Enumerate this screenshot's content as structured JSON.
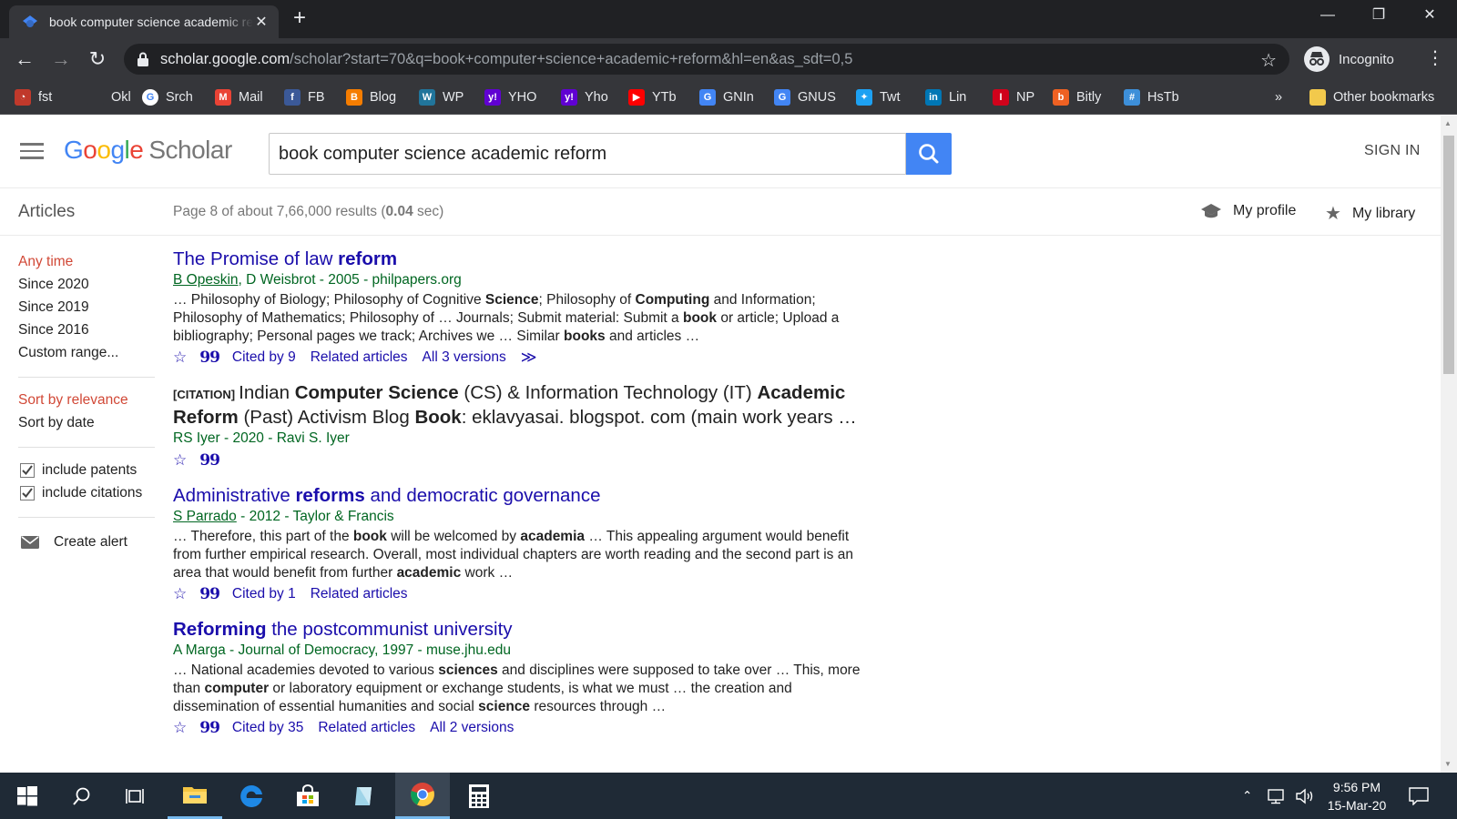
{
  "browser": {
    "tab_title": "book computer science academic reform",
    "url_host": "scholar.google.com",
    "url_path": "/scholar?start=70&q=book+computer+science+academic+reform&hl=en&as_sdt=0,5",
    "profile_label": "Incognito",
    "bookmarks": [
      {
        "label": "fst",
        "icon": "speedometer-icon",
        "color": "#c0392b"
      },
      {
        "label": "Okl",
        "icon": "ookla-icon",
        "color": "#35363a"
      },
      {
        "label": "Srch",
        "icon": "google-icon",
        "color": "#ffffff"
      },
      {
        "label": "Mail",
        "icon": "gmail-icon",
        "color": "#ea4335"
      },
      {
        "label": "FB",
        "icon": "facebook-icon",
        "color": "#3b5998"
      },
      {
        "label": "Blog",
        "icon": "blogger-icon",
        "color": "#f57d00"
      },
      {
        "label": "WP",
        "icon": "wordpress-icon",
        "color": "#21759b"
      },
      {
        "label": "YHO",
        "icon": "yahoo-icon",
        "color": "#6001d2"
      },
      {
        "label": "Yho",
        "icon": "yahoo-icon",
        "color": "#6001d2"
      },
      {
        "label": "YTb",
        "icon": "youtube-icon",
        "color": "#ff0000"
      },
      {
        "label": "GNIn",
        "icon": "google-news-icon",
        "color": "#4285f4"
      },
      {
        "label": "GNUS",
        "icon": "google-news-icon",
        "color": "#4285f4"
      },
      {
        "label": "Twt",
        "icon": "twitter-icon",
        "color": "#1da1f2"
      },
      {
        "label": "Lin",
        "icon": "linkedin-icon",
        "color": "#0077b5"
      },
      {
        "label": "NP",
        "icon": "np-icon",
        "color": "#d0021b"
      },
      {
        "label": "Bitly",
        "icon": "bitly-icon",
        "color": "#ee6123"
      },
      {
        "label": "HsTb",
        "icon": "hashtab-icon",
        "color": "#3d8fd9"
      }
    ],
    "overflow_label": "»",
    "other_bookmarks": "Other bookmarks"
  },
  "scholar": {
    "logo_google": "Google",
    "logo_scholar": "Scholar",
    "query": "book computer science academic reform",
    "sign_in": "SIGN IN",
    "articles_label": "Articles",
    "result_stats_pre": "Page 8 of about 7,66,000 results (",
    "result_stats_time": "0.04",
    "result_stats_post": " sec)",
    "my_profile": "My profile",
    "my_library": "My library",
    "time_filters": [
      "Any time",
      "Since 2020",
      "Since 2019",
      "Since 2016",
      "Custom range..."
    ],
    "sort_relevance": "Sort by relevance",
    "sort_date": "Sort by date",
    "include_patents": "include patents",
    "include_citations": "include citations",
    "create_alert": "Create alert"
  },
  "results": [
    {
      "title_parts": [
        [
          "The Promise of law ",
          false
        ],
        [
          "reform",
          true
        ]
      ],
      "authors": "B Opeskin",
      "meta_rest": ", D Weisbrot - 2005 - philpapers.org",
      "snippet": [
        [
          "… Philosophy of Biology; Philosophy of Cognitive ",
          false
        ],
        [
          "Science",
          true
        ],
        [
          "; Philosophy of ",
          false
        ],
        [
          "Computing",
          true
        ],
        [
          " and Information; Philosophy of Mathematics; Philosophy of … Journals; Submit material: Submit a ",
          false
        ],
        [
          "book",
          true
        ],
        [
          " or article; Upload a bibliography; Personal pages we track; Archives we … Similar ",
          false
        ],
        [
          "books",
          true
        ],
        [
          " and articles …",
          false
        ]
      ],
      "cited": "Cited by 9",
      "related": "Related articles",
      "versions": "All 3 versions"
    },
    {
      "citation_tag": "[CITATION]",
      "title_parts": [
        [
          "Indian ",
          false
        ],
        [
          "Computer Science",
          true
        ],
        [
          " (CS) & Information Technology (IT) ",
          false
        ],
        [
          "Academic Reform",
          true
        ],
        [
          " (Past) Activism Blog ",
          false
        ],
        [
          "Book",
          true
        ],
        [
          ": eklavyasai. blogspot. com (main work years …",
          false
        ]
      ],
      "meta_plain": "RS Iyer - 2020 - Ravi S. Iyer"
    },
    {
      "title_parts": [
        [
          "Administrative ",
          false
        ],
        [
          "reforms",
          true
        ],
        [
          " and democratic governance",
          false
        ]
      ],
      "authors": "S Parrado",
      "meta_rest": " - 2012 - Taylor & Francis",
      "snippet": [
        [
          "… Therefore, this part of the ",
          false
        ],
        [
          "book",
          true
        ],
        [
          " will be welcomed by ",
          false
        ],
        [
          "academia",
          true
        ],
        [
          " … This appealing argument would benefit from further empirical research. Overall, most individual chapters are worth reading and the second part is an area that would benefit from further ",
          false
        ],
        [
          "academic",
          true
        ],
        [
          " work …",
          false
        ]
      ],
      "cited": "Cited by 1",
      "related": "Related articles"
    },
    {
      "title_parts": [
        [
          "Reforming",
          true
        ],
        [
          " the postcommunist university",
          false
        ]
      ],
      "meta_plain": "A Marga - Journal of Democracy, 1997 - muse.jhu.edu",
      "snippet": [
        [
          "… National academies devoted to various ",
          false
        ],
        [
          "sciences",
          true
        ],
        [
          " and disciplines were supposed to take over … This, more than ",
          false
        ],
        [
          "computer",
          true
        ],
        [
          " or laboratory equipment or exchange students, is what we must … the creation and dissemination of essential humanities and social ",
          false
        ],
        [
          "science",
          true
        ],
        [
          " resources through …",
          false
        ]
      ],
      "cited": "Cited by 35",
      "related": "Related articles",
      "versions": "All 2 versions"
    }
  ],
  "taskbar": {
    "time": "9:56 PM",
    "date": "15-Mar-20"
  }
}
